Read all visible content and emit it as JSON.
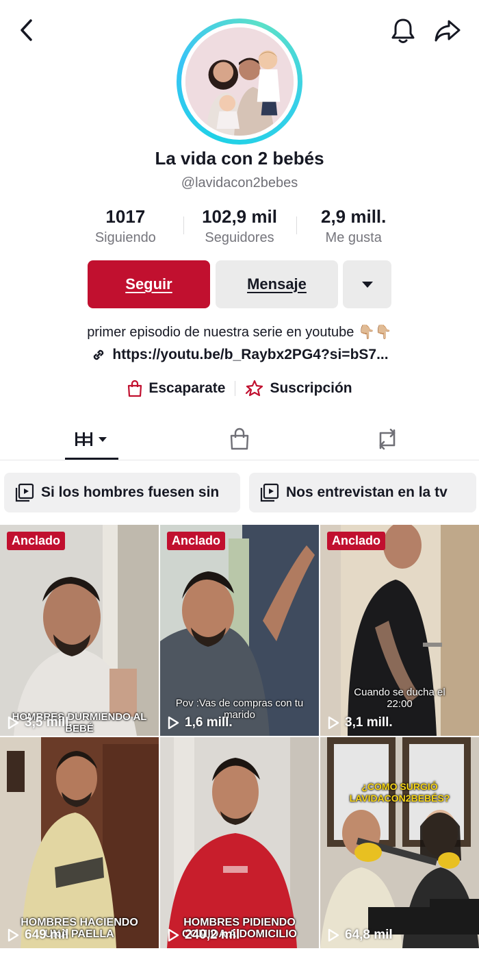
{
  "header": {
    "back_icon": "chevron-left-icon",
    "bell_icon": "bell-icon",
    "share_icon": "share-arrow-icon",
    "ring_colors": [
      "#1fd1e6",
      "#5ce0c8"
    ]
  },
  "profile": {
    "name": "La vida con 2 bebés",
    "handle": "@lavidacon2bebes",
    "stats": [
      {
        "value": "1017",
        "label": "Siguiendo"
      },
      {
        "value": "102,9 mil",
        "label": "Seguidores"
      },
      {
        "value": "2,9 mill.",
        "label": "Me gusta"
      }
    ],
    "follow_label": "Seguir",
    "message_label": "Mensaje",
    "bio": "primer episodio de nuestra serie en youtube 👇🏼👇🏼",
    "link": "https://youtu.be/b_Raybx2PG4?si=bS7...",
    "shop_label": "Escaparate",
    "subscription_label": "Suscripción",
    "accent_color": "#c1102f"
  },
  "tabs": {
    "videos_icon": "grid-icon",
    "shop_icon": "shopping-bag-icon",
    "reposts_icon": "repost-icon"
  },
  "playlists": [
    {
      "title": "Si los hombres fuesen sin"
    },
    {
      "title": "Nos entrevistan en la tv"
    }
  ],
  "videos": [
    {
      "pinned": "Anclado",
      "caption": "Hombres durmiendo al bebé",
      "views": "3,5 mill."
    },
    {
      "pinned": "Anclado",
      "caption": "Pov :Vas de compras con tu marido",
      "views": "1,6 mill."
    },
    {
      "pinned": "Anclado",
      "caption": "Cuando se ducha el 22:00",
      "views": "3,1 mill."
    },
    {
      "pinned": "",
      "caption": "Hombres haciendo una paella",
      "views": "649 mil"
    },
    {
      "pinned": "",
      "caption": "Hombres pidiendo comida a domicilio",
      "views": "240,2 mil"
    },
    {
      "pinned": "",
      "caption": "¿Como surgió lavidacon2bebés?",
      "views": "64,8 mil"
    }
  ]
}
